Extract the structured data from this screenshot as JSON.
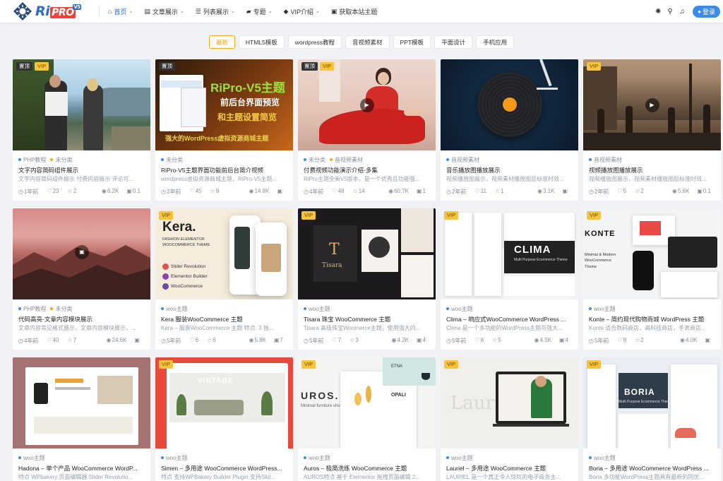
{
  "header": {
    "logo_text": "Ri",
    "logo_pro": "PRO",
    "logo_version": "V5",
    "nav": [
      {
        "label": "首页",
        "icon": "home-icon",
        "glyph": "⌂",
        "dropdown": true,
        "active": true
      },
      {
        "label": "文章展示",
        "icon": "file-icon",
        "glyph": "▤",
        "dropdown": true,
        "active": false
      },
      {
        "label": "列表展示",
        "icon": "list-icon",
        "glyph": "☰",
        "dropdown": true,
        "active": false
      },
      {
        "label": "专题",
        "icon": "folder-icon",
        "glyph": "▰",
        "dropdown": true,
        "active": false
      },
      {
        "label": "VIP介绍",
        "icon": "diamond-icon",
        "glyph": "◆",
        "dropdown": true,
        "active": false
      },
      {
        "label": "获取本站主题",
        "icon": "bookmark-icon",
        "glyph": "▣",
        "dropdown": false,
        "active": false
      }
    ],
    "right_icons": [
      {
        "name": "settings-icon",
        "glyph": "✺"
      },
      {
        "name": "search-icon",
        "glyph": "⚲"
      },
      {
        "name": "notification-bell-icon",
        "glyph": "♫"
      }
    ],
    "login_label": "登录"
  },
  "tabs": [
    "最新",
    "HTML5模板",
    "wordpress教程",
    "音视频素材",
    "PPT模板",
    "平面设计",
    "手机应用"
  ],
  "badges": {
    "top": "置顶",
    "vip": "VIP"
  },
  "posts": [
    {
      "cats": [
        "PHP教程",
        "未分类"
      ],
      "title": "文字内容简码组件展示",
      "desc": "文字内容简码组件展示 付费内容展示 评论可...",
      "time": "1年前",
      "likes": "23",
      "favs": "2",
      "views": "6.2K",
      "comments": "0.1",
      "top": true,
      "vip": true,
      "video": false
    },
    {
      "cats": [
        "未分类"
      ],
      "title": "RiPro-V5主题界面功能前后台简介视频",
      "desc": "wordpress虚拟资源商城主题，RiPro-V5主题...",
      "time": "2年前",
      "likes": "45",
      "favs": "9",
      "views": "14.8K",
      "comments": "",
      "top": true,
      "vip": false,
      "video": false
    },
    {
      "cats": [
        "未分类",
        "音视频素材"
      ],
      "title": "付费视频功能演示介绍-多集",
      "desc": "RiPro主题全新V5版本，是一个优秀且功能强...",
      "time": "4年前",
      "likes": "48",
      "favs": "14",
      "views": "60.7K",
      "comments": "1",
      "top": true,
      "vip": true,
      "video": true
    },
    {
      "cats": [
        "音视频素材"
      ],
      "title": "音乐播放图播放展示",
      "desc": "视频播放图展示，视频素材播放图层标准时效...",
      "time": "2年前",
      "likes": "11",
      "favs": "1",
      "views": "3.1K",
      "comments": "",
      "top": false,
      "vip": false,
      "video": false
    },
    {
      "cats": [
        "音视频素材"
      ],
      "title": "视频播放图播放展示",
      "desc": "视频播放图展示，视频素材播放图层标准时效...",
      "time": "2年前",
      "likes": "5",
      "favs": "2",
      "views": "5.6K",
      "comments": "0.1",
      "top": false,
      "vip": true,
      "video": true
    },
    {
      "cats": [
        "PHP教程",
        "未分类"
      ],
      "title": "代码高亮-文章内容模块展示",
      "desc": "文章内容常见格式展示，文章内容模块展示，...",
      "time": "4年前",
      "likes": "40",
      "favs": "7",
      "views": "24.6K",
      "comments": "",
      "top": false,
      "vip": false,
      "video": false
    },
    {
      "cats": [
        "woo主题"
      ],
      "title": "Kera 服装WooCommerce 主题",
      "desc": "Kera – 服装WooCommerce 主题 特点: 3 独...",
      "time": "5年前",
      "likes": "6",
      "favs": "6",
      "views": "5.8K",
      "comments": "7",
      "top": false,
      "vip": true,
      "video": false
    },
    {
      "cats": [
        "woo主题"
      ],
      "title": "Tisara 珠宝 WooCommerce 主题",
      "desc": "Tisara 高级珠宝Woomerce主题，使用强大的...",
      "time": "5年前",
      "likes": "7",
      "favs": "3",
      "views": "4.2K",
      "comments": "4",
      "top": false,
      "vip": true,
      "video": false
    },
    {
      "cats": [
        "woo主题"
      ],
      "title": "Clima – 响应式WooCommerce WordPress ...",
      "desc": "Clima 是一个多功能的WordPress主题与强大...",
      "time": "5年前",
      "likes": "8",
      "favs": "5",
      "views": "4.5K",
      "comments": "4",
      "top": false,
      "vip": true,
      "video": false
    },
    {
      "cats": [
        "woo主题"
      ],
      "title": "Konte – 简约现代购物商城 WordPress 主题",
      "desc": "Konte 适合数码商店，高科技商店，手表商店...",
      "time": "5年前",
      "likes": "8",
      "favs": "2",
      "views": "4.0K",
      "comments": "",
      "top": false,
      "vip": true,
      "video": false
    },
    {
      "cats": [
        "woo主题"
      ],
      "title": "Hadona – 单个产品 WooCommerce WordP...",
      "desc": "特点 WPbakery 页面编辑器 Slider Revolutio...",
      "time": "",
      "likes": "",
      "favs": "",
      "views": "",
      "comments": "",
      "top": false,
      "vip": false,
      "video": false
    },
    {
      "cats": [
        "woo主题"
      ],
      "title": "Simen – 多用途 WooCommerce WordPress...",
      "desc": "特点 支持WPBakery Builder Plugin 支持Slid...",
      "time": "",
      "likes": "",
      "favs": "",
      "views": "",
      "comments": "",
      "top": false,
      "vip": true,
      "video": false
    },
    {
      "cats": [
        "woo主题"
      ],
      "title": "Auros – 极简洗练 WooCommerce 主题",
      "desc": "AUROS特点 基于 Elementor 拖拽页面编辑 2...",
      "time": "",
      "likes": "",
      "favs": "",
      "views": "",
      "comments": "",
      "top": false,
      "vip": true,
      "video": false
    },
    {
      "cats": [
        "woo主题"
      ],
      "title": "Lauriel – 多用途 WooCommerce 主题",
      "desc": "LAURIEL 是一个真正令人惊叹的电子商务主...",
      "time": "",
      "likes": "",
      "favs": "",
      "views": "",
      "comments": "",
      "top": false,
      "vip": true,
      "video": false
    },
    {
      "cats": [
        "woo主题"
      ],
      "title": "Boria – 多用途 WooCommerce WordPress ...",
      "desc": "Boria 多功能WordPress主题具有最新的同优...",
      "time": "",
      "likes": "",
      "favs": "",
      "views": "",
      "comments": "",
      "top": false,
      "vip": true,
      "video": false
    }
  ],
  "thumb_text": {
    "t2_brand": "RiPro-V5主题",
    "t2_line1": "前后台界面预览",
    "t2_line2": "和主题设置简览",
    "t2_line3": "强大的WordPress虚拟资源商城主题",
    "t7_title": "Kera.",
    "t7_sub": "FASHION ELEMENTOR WOOCOMMERCE THEME",
    "t7_p1": "Slider Revolution",
    "t7_p2": "Elementor Builder",
    "t7_p3": "WooCommerce",
    "t8_title": "Tisara",
    "t9_title": "CLIMA",
    "t9_sub": "Multi Purpose Ecommerce Theme",
    "t10_title": "KONTE",
    "t10_sub": "Minimal & Modern WooCommerce Theme",
    "t12_word": "VINTAGE",
    "t13_title": "UROS.",
    "t13_sub": "Minimal furniture shop",
    "t13_prod": "OPALI",
    "t13_prod2": "ETNA",
    "t14_bg": "Lauriel",
    "t15_title": "BORIA",
    "t15_sub": "Multi Purpose Ecommerce Theme"
  }
}
